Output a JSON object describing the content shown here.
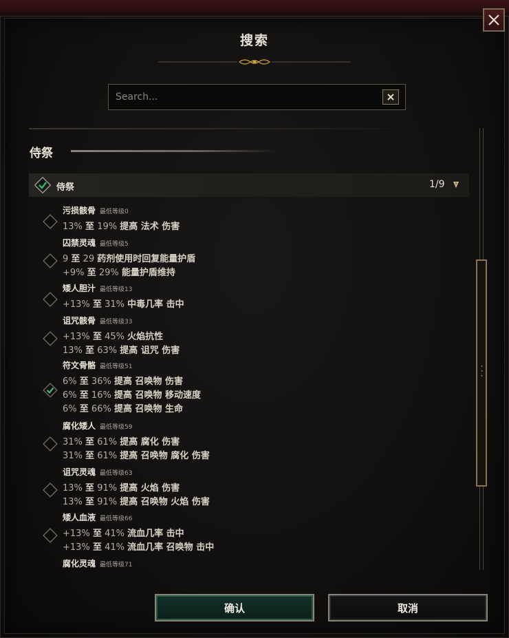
{
  "dialog": {
    "title": "搜索",
    "search_placeholder": "Search...",
    "search_value": ""
  },
  "section": {
    "title": "侍祭"
  },
  "category": {
    "label": "侍祭",
    "count": "1/9",
    "checked": true
  },
  "items": [
    {
      "name": "污损骸骨",
      "level": "最低等级0",
      "checked": false,
      "lines": [
        {
          "a": "13%",
          "mid": "至",
          "b": "19%",
          "rest": "提高 法术 伤害"
        }
      ]
    },
    {
      "name": "囚禁灵魂",
      "level": "最低等级5",
      "checked": false,
      "lines": [
        {
          "a": "9",
          "mid": "至",
          "b": "29",
          "rest": "药剂使用时回复能量护盾"
        },
        {
          "a": "+9%",
          "mid": "至",
          "b": "29%",
          "rest": "能量护盾维持"
        }
      ]
    },
    {
      "name": "矮人胆汁",
      "level": "最低等级13",
      "checked": false,
      "lines": [
        {
          "a": "+13%",
          "mid": "至",
          "b": "31%",
          "rest": "中毒几率 击中"
        }
      ]
    },
    {
      "name": "诅咒骸骨",
      "level": "最低等级33",
      "checked": false,
      "lines": [
        {
          "a": "+13%",
          "mid": "至",
          "b": "45%",
          "rest": "火焰抗性"
        },
        {
          "a": "13%",
          "mid": "至",
          "b": "63%",
          "rest": "提高 诅咒 伤害"
        }
      ]
    },
    {
      "name": "符文骨骼",
      "level": "最低等级51",
      "checked": true,
      "lines": [
        {
          "a": "6%",
          "mid": "至",
          "b": "36%",
          "rest": "提高 召唤物 伤害"
        },
        {
          "a": "6%",
          "mid": "至",
          "b": "16%",
          "rest": "提高 召唤物 移动速度"
        },
        {
          "a": "6%",
          "mid": "至",
          "b": "66%",
          "rest": "提高 召唤物 生命"
        }
      ]
    },
    {
      "name": "腐化矮人",
      "level": "最低等级59",
      "checked": false,
      "lines": [
        {
          "a": "31%",
          "mid": "至",
          "b": "61%",
          "rest": "提高 腐化 伤害"
        },
        {
          "a": "31%",
          "mid": "至",
          "b": "61%",
          "rest": "提高 召唤物 腐化 伤害"
        }
      ]
    },
    {
      "name": "诅咒灵魂",
      "level": "最低等级63",
      "checked": false,
      "lines": [
        {
          "a": "13%",
          "mid": "至",
          "b": "91%",
          "rest": "提高 火焰 伤害"
        },
        {
          "a": "13%",
          "mid": "至",
          "b": "91%",
          "rest": "提高 召唤物 火焰 伤害"
        }
      ]
    },
    {
      "name": "矮人血液",
      "level": "最低等级66",
      "checked": false,
      "lines": [
        {
          "a": "+13%",
          "mid": "至",
          "b": "41%",
          "rest": "流血几率 击中"
        },
        {
          "a": "+13%",
          "mid": "至",
          "b": "41%",
          "rest": "流血几率 召唤物 击中"
        }
      ]
    },
    {
      "name": "腐化灵魂",
      "level": "最低等级71",
      "checked": false,
      "lines": []
    }
  ],
  "buttons": {
    "confirm": "确认",
    "cancel": "取消"
  },
  "colors": {
    "accent_green": "#2f8a5a",
    "frame_red": "#3a1414",
    "gold": "#8a7452"
  }
}
